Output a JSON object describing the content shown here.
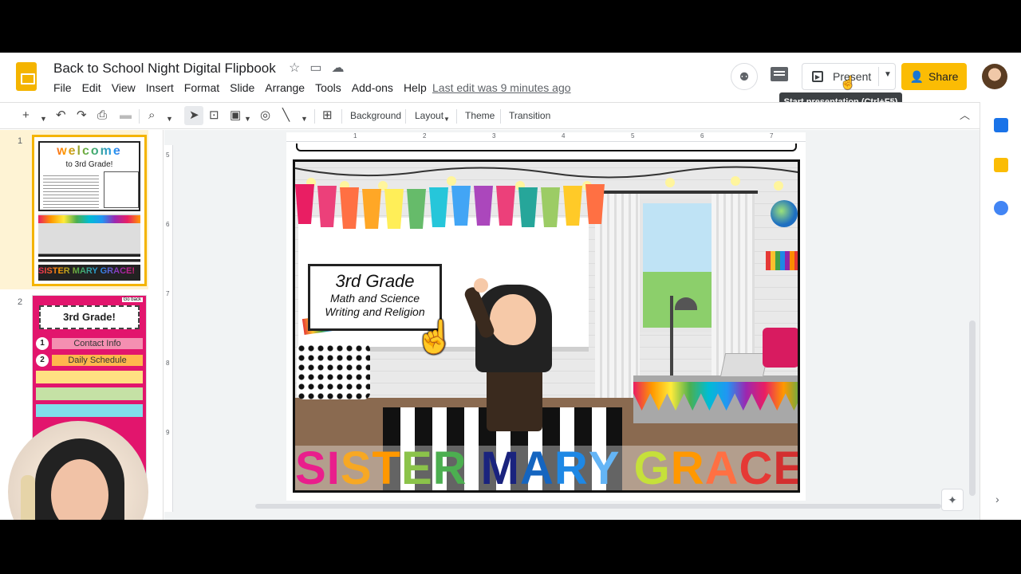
{
  "header": {
    "doc_title": "Back to School Night Digital Flipbook",
    "last_edit": "Last edit was 9 minutes ago",
    "present_label": "Present",
    "share_label": "Share",
    "tooltip": "Start presentation (Ctrl+F5)"
  },
  "menu": [
    "File",
    "Edit",
    "View",
    "Insert",
    "Format",
    "Slide",
    "Arrange",
    "Tools",
    "Add-ons",
    "Help"
  ],
  "toolbar": {
    "background": "Background",
    "layout": "Layout",
    "theme": "Theme",
    "transition": "Transition"
  },
  "ruler": {
    "h": [
      "1",
      "2",
      "3",
      "4",
      "5",
      "6",
      "7"
    ],
    "v": [
      "5",
      "6",
      "7",
      "8",
      "9"
    ]
  },
  "filmstrip": {
    "slides": [
      {
        "number": "1",
        "welcome": "welcome",
        "to_grade": "to 3rd Grade!",
        "name": "SISTER MARY GRACE!"
      },
      {
        "number": "2",
        "go_back": "Go back",
        "title": "3rd Grade!",
        "items": [
          {
            "num": "1",
            "label": "Contact Info"
          },
          {
            "num": "2",
            "label": "Daily Schedule"
          }
        ]
      }
    ]
  },
  "slide": {
    "sign_title": "3rd Grade",
    "sign_line1": "Math and Science",
    "sign_line2": "Writing and Religion",
    "name_letters": [
      "S",
      "I",
      "S",
      "T",
      "E",
      "R",
      " ",
      "M",
      "A",
      "R",
      "Y",
      " ",
      "G",
      "R",
      "A",
      "C",
      "E",
      "!"
    ],
    "name_colors": [
      "#e91e8c",
      "#e91e8c",
      "#f7a823",
      "#ff9800",
      "#8bc34a",
      "#4caf50",
      "#ffffff",
      "#1a237e",
      "#1565c0",
      "#1e88e5",
      "#64b5f6",
      "#ffffff",
      "#c6e03a",
      "#ff9800",
      "#ff7043",
      "#e53935",
      "#d32f2f",
      "#e91e63"
    ]
  },
  "colors": {
    "accent": "#f4b400",
    "share": "#fbbc04",
    "record_done": "#2ecc71"
  },
  "icons": {
    "star": "★",
    "folder": "▭",
    "cloud": "☁"
  }
}
